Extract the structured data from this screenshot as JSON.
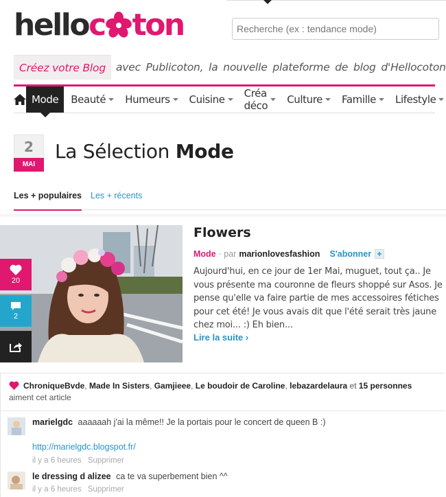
{
  "header": {
    "logo_part1": "hello",
    "logo_part2": "ton",
    "search_placeholder": "Recherche (ex : tendance mode)"
  },
  "promo": {
    "highlight": "Créez votre Blog",
    "text": "avec Publicoton, la nouvelle plateforme de blog d'Hellocoton"
  },
  "nav": {
    "home_icon": "home-icon",
    "items": [
      {
        "label": "Mode"
      },
      {
        "label": "Beauté"
      },
      {
        "label": "Humeurs"
      },
      {
        "label": "Cuisine"
      },
      {
        "label": "Créa déco"
      },
      {
        "label": "Culture"
      },
      {
        "label": "Famille"
      },
      {
        "label": "Lifestyle"
      }
    ]
  },
  "date": {
    "day": "2",
    "month": "MAI"
  },
  "page_title": {
    "prefix": "La Sélection",
    "bold": "Mode"
  },
  "tabs": {
    "popular": "Les + populaires",
    "recent": "Les + récents"
  },
  "article": {
    "title": "Flowers",
    "category": "Mode",
    "by": "· par",
    "author": "marionlovesfashion",
    "subscribe": "S'abonner",
    "plus": "+",
    "excerpt": "Aujourd'hui, en ce jour de 1er Mai, muguet, tout ça.. Je vous présente ma couronne de fleurs shoppé sur Asos. Je pense qu'elle va faire partie de mes accessoires fétiches pour cet été! Je vous avais dit que l'été serait très jaune chez moi... :) Eh bien...",
    "read_more": "Lire la suite ›",
    "likes_count": "20",
    "comments_count": "2"
  },
  "likes": {
    "names": [
      "ChroniqueBvde",
      "Made In Sisters",
      "Gamjieee",
      "Le boudoir de Caroline",
      "lebazardelaura"
    ],
    "and": "et",
    "people": "15 personnes",
    "suffix": "aiment cet article"
  },
  "comments": [
    {
      "user": "marielgdc",
      "text": "aaaaaah j'ai la même!! Je la portais pour le concert de queen B :)",
      "link": "http://marielgdc.blogspot.fr/",
      "time": "il y a 6 heures",
      "delete": "Supprimer"
    },
    {
      "user": "le dressing d alizee",
      "text": "ca te va superbement bien ^^",
      "time": "il y a 6 heures",
      "delete": "Supprimer"
    }
  ],
  "colors": {
    "brand_pink": "#e0186f",
    "link_blue": "#2a93c4",
    "comment_blue": "#24a6cc",
    "dark": "#222222"
  }
}
